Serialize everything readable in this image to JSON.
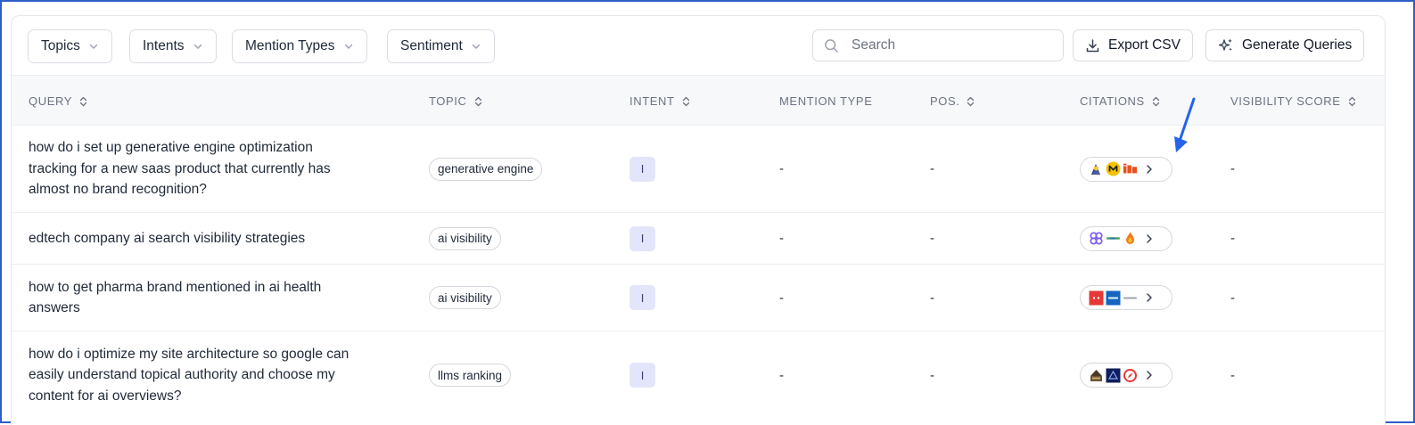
{
  "filters": {
    "topics": "Topics",
    "intents": "Intents",
    "mention_types": "Mention Types",
    "sentiment": "Sentiment"
  },
  "search": {
    "placeholder": "Search"
  },
  "actions": {
    "export_csv": "Export CSV",
    "generate_queries": "Generate Queries"
  },
  "columns": {
    "query": "QUERY",
    "topic": "TOPIC",
    "intent": "INTENT",
    "mention_type": "MENTION TYPE",
    "position": "POS.",
    "citations": "CITATIONS",
    "visibility_score": "VISIBILITY SCORE"
  },
  "rows": [
    {
      "query": "how do i set up generative engine optimization tracking for a new saas product that currently has almost no brand recognition?",
      "topic": "generative engine",
      "intent": "I",
      "mention_type": "-",
      "position": "-",
      "visibility_score": "-",
      "citation_icons": [
        "rocket-person-icon",
        "yellow-m-icon",
        "orange-logo-icon"
      ]
    },
    {
      "query": "edtech company ai search visibility strategies",
      "topic": "ai visibility",
      "intent": "I",
      "mention_type": "-",
      "position": "-",
      "visibility_score": "-",
      "citation_icons": [
        "purple-clover-icon",
        "green-text-logo-icon",
        "orange-flame-icon"
      ]
    },
    {
      "query": "how to get pharma brand mentioned in ai health answers",
      "topic": "ai visibility",
      "intent": "I",
      "mention_type": "-",
      "position": "-",
      "visibility_score": "-",
      "citation_icons": [
        "red-square-logo-icon",
        "blue-square-logo-icon",
        "grey-text-logo-icon"
      ]
    },
    {
      "query": "how do i optimize my site architecture so google can easily understand topical authority and choose my content for ai overviews?",
      "topic": "llms ranking",
      "intent": "I",
      "mention_type": "-",
      "position": "-",
      "visibility_score": "-",
      "citation_icons": [
        "bronze-badge-icon",
        "navy-square-icon",
        "red-compass-icon"
      ]
    }
  ],
  "colors": {
    "frame_border": "#2b5fc7",
    "intent_badge_bg": "#e3e6fb",
    "annotation_arrow": "#2563eb"
  }
}
